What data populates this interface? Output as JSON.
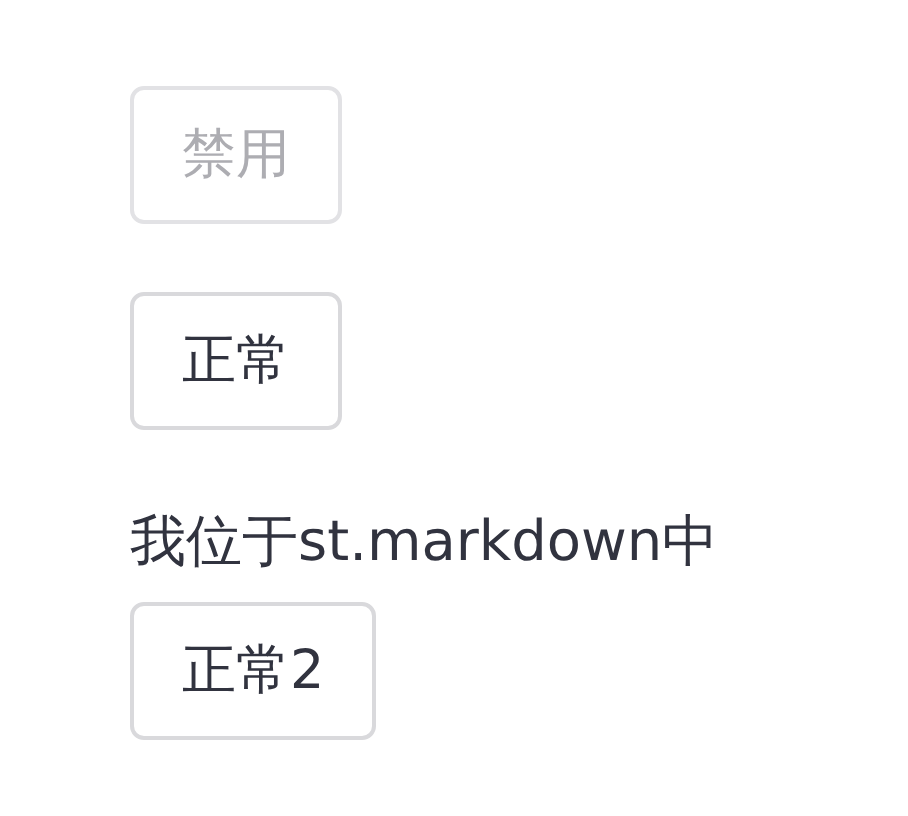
{
  "items": [
    {
      "kind": "button",
      "label": "禁用",
      "disabled": true
    },
    {
      "kind": "button",
      "label": "正常",
      "disabled": false
    },
    {
      "kind": "text",
      "text": "我位于st.markdown中"
    },
    {
      "kind": "button",
      "label": "正常2",
      "disabled": false
    }
  ]
}
